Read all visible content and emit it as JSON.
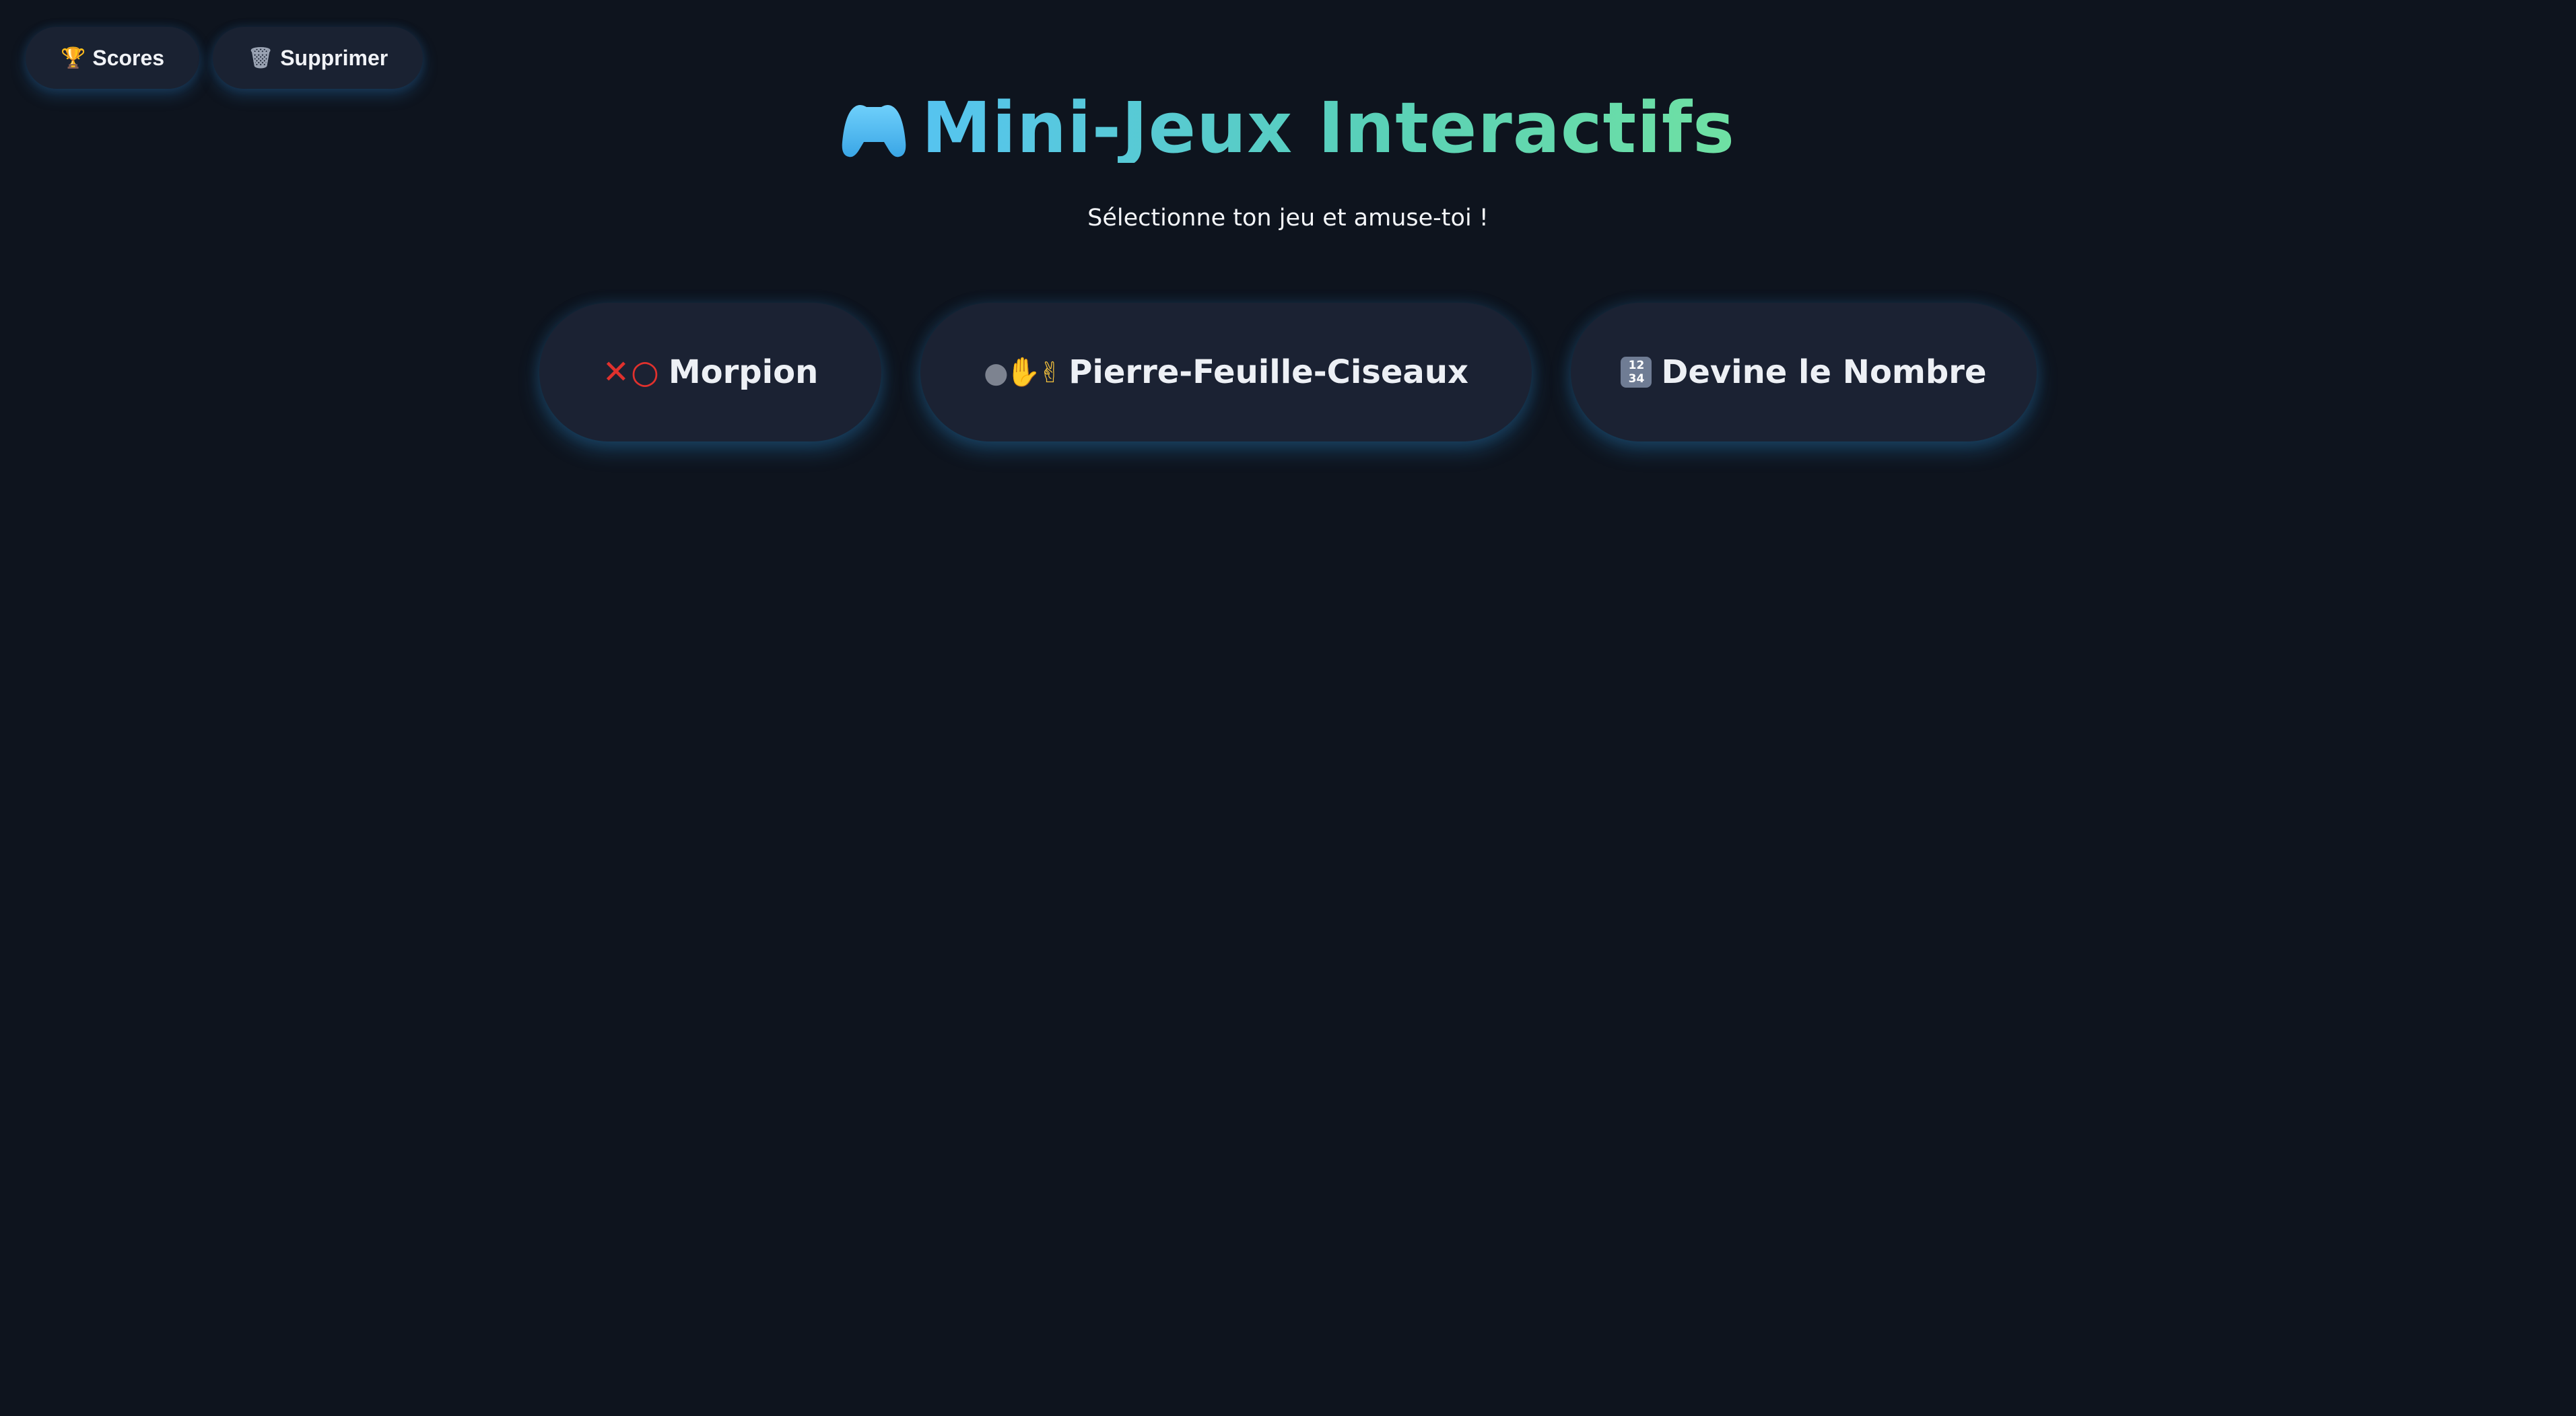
{
  "header": {
    "scores_label": "Scores",
    "scores_icon": "trophy-icon",
    "delete_label": "Supprimer",
    "delete_icon": "trash-icon"
  },
  "title": "Mini-Jeux Interactifs",
  "title_icon": "gamepad-icon",
  "subtitle": "Sélectionne ton jeu et amuse-toi !",
  "games": [
    {
      "label": "Morpion",
      "icon": "x-o-icon"
    },
    {
      "label": "Pierre-Feuille-Ciseaux",
      "icon": "rock-paper-scissors-icon"
    },
    {
      "label": "Devine le Nombre",
      "icon": "numbers-icon"
    }
  ],
  "colors": {
    "background": "#0e141e",
    "button": "#1b2233",
    "title_gradient_start": "#56c4f0",
    "title_gradient_end": "#6fe1a3",
    "glow": "#2878b4"
  }
}
